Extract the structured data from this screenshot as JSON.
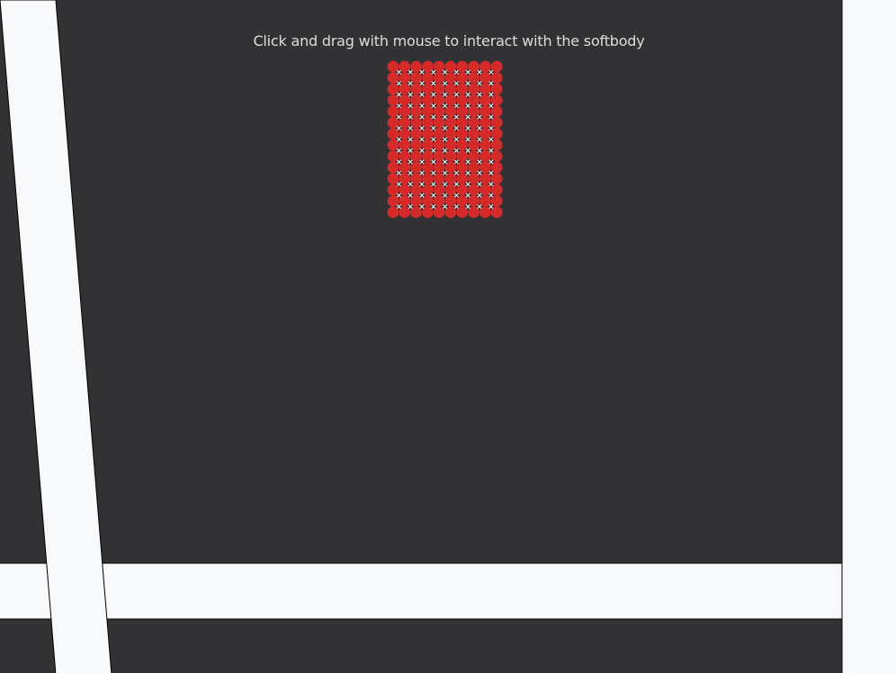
{
  "instruction_text": "Click and drag with mouse to interact with the softbody",
  "softbody": {
    "columns": 10,
    "rows": 14,
    "particle_color": "#d42a2a",
    "marker_color": "#ffffff",
    "marker_glyph": "cross"
  },
  "colors": {
    "background": "#323234",
    "wall": "#f8f9fb",
    "wall_edge": "#000000"
  }
}
